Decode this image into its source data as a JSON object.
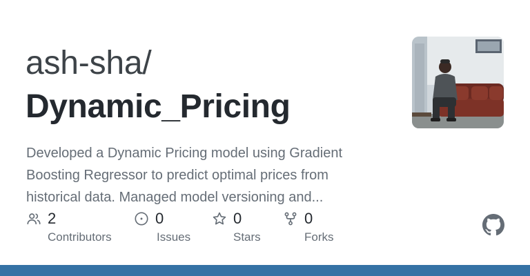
{
  "repo": {
    "owner": "ash-sha/",
    "name": "Dynamic_Pricing",
    "description_lines": [
      "Developed a Dynamic Pricing model using Gradient",
      "Boosting Regressor to predict optimal prices from",
      "historical data. Managed model versioning and..."
    ]
  },
  "stats": {
    "contributors": {
      "count": "2",
      "label": "Contributors",
      "icon": "people-icon"
    },
    "issues": {
      "count": "0",
      "label": "Issues",
      "icon": "issue-opened-icon"
    },
    "stars": {
      "count": "0",
      "label": "Stars",
      "icon": "star-icon"
    },
    "forks": {
      "count": "0",
      "label": "Forks",
      "icon": "repo-forked-icon"
    }
  },
  "branding": {
    "logo_icon": "github-mark-icon",
    "language_bar_color": "#3572a5"
  }
}
